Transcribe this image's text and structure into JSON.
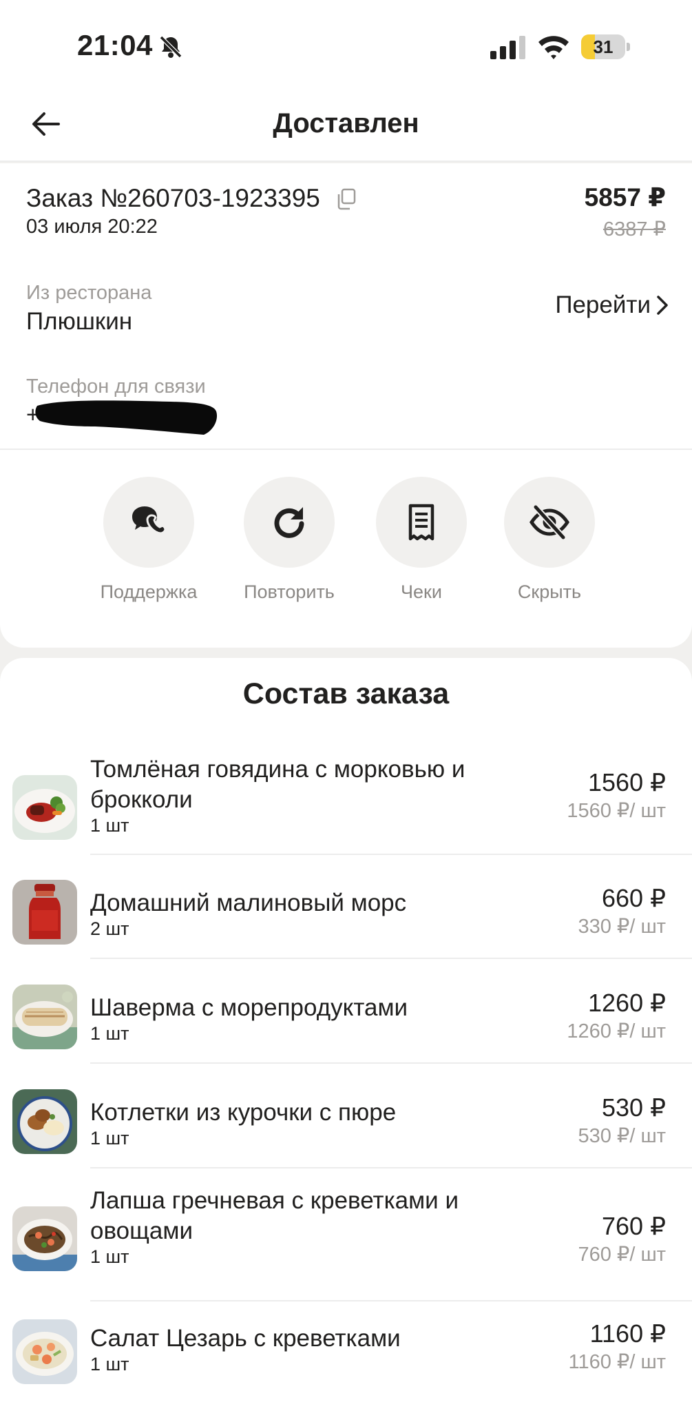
{
  "status_bar": {
    "time": "21:04",
    "battery_level": 31,
    "battery_label": "31",
    "icons": [
      "bell-muted-icon",
      "cellular-signal-icon",
      "wifi-icon",
      "battery-icon"
    ]
  },
  "header": {
    "title": "Доставлен",
    "back_icon": "arrow-left-icon"
  },
  "order": {
    "number_label": "Заказ №260703-1923395",
    "date": "03 июля 20:22",
    "total": "5857 ₽",
    "old_total": "6387 ₽",
    "restaurant_caption": "Из ресторана",
    "restaurant_name": "Плюшкин",
    "goto_label": "Перейти",
    "phone_caption": "Телефон для связи",
    "phone_prefix": "+"
  },
  "actions": [
    {
      "label": "Поддержка",
      "icon": "phone-support-icon"
    },
    {
      "label": "Повторить",
      "icon": "repeat-icon"
    },
    {
      "label": "Чеки",
      "icon": "receipt-icon"
    },
    {
      "label": "Скрыть",
      "icon": "eye-off-icon"
    }
  ],
  "composition": {
    "title": "Состав заказа",
    "items": [
      {
        "name": "Томлёная говядина с морковью и брокколи",
        "qty": "1 шт",
        "price": "1560 ₽",
        "unit_price": "1560 ₽/ шт"
      },
      {
        "name": "Домашний малиновый морс",
        "qty": "2 шт",
        "price": "660 ₽",
        "unit_price": "330 ₽/ шт"
      },
      {
        "name": "Шаверма с морепродуктами",
        "qty": "1 шт",
        "price": "1260 ₽",
        "unit_price": "1260 ₽/ шт"
      },
      {
        "name": "Котлетки из курочки с пюре",
        "qty": "1 шт",
        "price": "530 ₽",
        "unit_price": "530 ₽/ шт"
      },
      {
        "name": "Лапша гречневая с креветками и овощами",
        "qty": "1 шт",
        "price": "760 ₽",
        "unit_price": "760 ₽/ шт"
      },
      {
        "name": "Салат Цезарь с креветками",
        "qty": "1 шт",
        "price": "1160 ₽",
        "unit_price": "1160 ₽/ шт"
      }
    ]
  },
  "colors": {
    "text": "#21201f",
    "muted": "#9e9b98",
    "background": "#f1f0ee",
    "battery": "#f5cc35"
  }
}
